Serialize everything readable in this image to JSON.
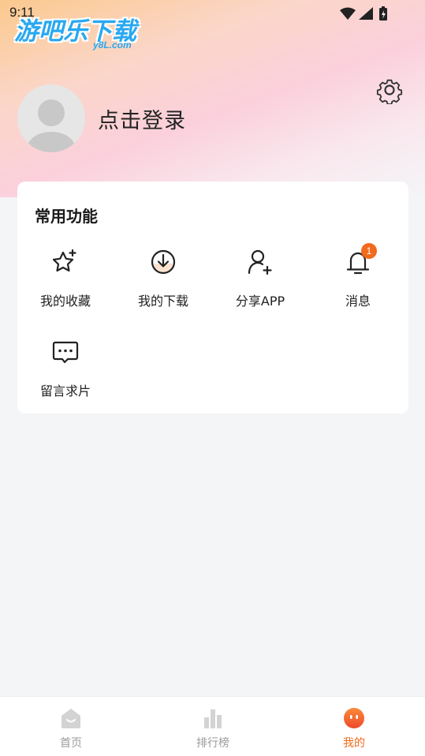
{
  "status_bar": {
    "time": "9:11"
  },
  "watermark": {
    "text": "游吧乐下载",
    "sub": "y8L.com"
  },
  "profile": {
    "login_label": "点击登录"
  },
  "functions": {
    "title": "常用功能",
    "items": [
      {
        "label": "我的收藏",
        "icon": "star-sparkle-icon"
      },
      {
        "label": "我的下载",
        "icon": "download-icon"
      },
      {
        "label": "分享APP",
        "icon": "add-user-icon"
      },
      {
        "label": "消息",
        "icon": "bell-icon",
        "badge": "1"
      },
      {
        "label": "留言求片",
        "icon": "chat-bubble-icon"
      }
    ]
  },
  "bottom_nav": {
    "items": [
      {
        "label": "首页",
        "icon": "home-icon",
        "active": false
      },
      {
        "label": "排行榜",
        "icon": "ranking-icon",
        "active": false
      },
      {
        "label": "我的",
        "icon": "profile-face-icon",
        "active": true
      }
    ]
  },
  "colors": {
    "accent": "#f26a1b",
    "inactive": "#9a9a9a",
    "watermark": "#29a8f0"
  }
}
